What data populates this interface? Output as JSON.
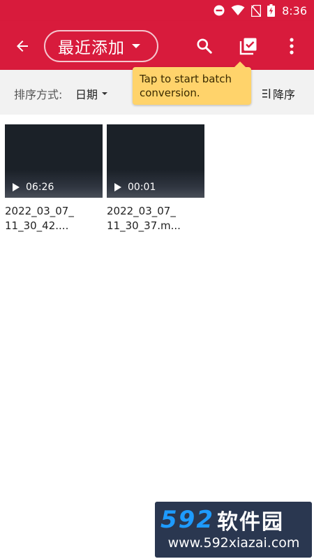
{
  "status_bar": {
    "time": "8:36",
    "icons": [
      "do-not-disturb-icon",
      "wifi-icon",
      "no-sim-icon",
      "battery-charging-icon"
    ]
  },
  "app_bar": {
    "title": "最近添加",
    "icons": {
      "back": "arrow-left-icon",
      "search": "search-icon",
      "batch": "checklist-icon",
      "more": "more-vert-icon"
    }
  },
  "tooltip": {
    "line1": "Tap to start batch",
    "line2": "conversion."
  },
  "sort_bar": {
    "label": "排序方式:",
    "value": "日期",
    "order": "降序"
  },
  "videos": [
    {
      "duration": "06:26",
      "name_line1": "2022_03_07_",
      "name_line2": "11_30_42...."
    },
    {
      "duration": "00:01",
      "name_line1": "2022_03_07_",
      "name_line2": "11_30_37.m..."
    }
  ],
  "watermark": {
    "logo_number": "592",
    "logo_text": "软件园",
    "url": "www.592xiazai.com"
  },
  "colors": {
    "primary": "#d81b3c",
    "tooltip": "#ffd36b",
    "sort_bar_bg": "#f2f2f2",
    "watermark_bg": "#2a3750",
    "watermark_accent": "#1e9bff"
  }
}
